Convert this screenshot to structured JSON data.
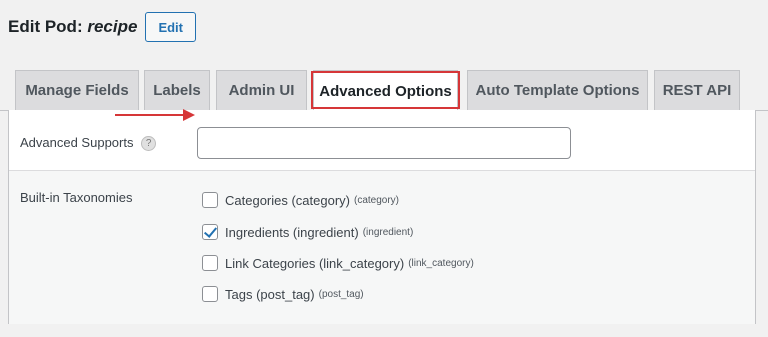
{
  "header": {
    "title_prefix": "Edit Pod:",
    "pod_name": "recipe",
    "edit_label": "Edit"
  },
  "tabs": [
    {
      "label": "Manage Fields"
    },
    {
      "label": "Labels"
    },
    {
      "label": "Admin UI"
    },
    {
      "label": "Advanced Options",
      "active": true
    },
    {
      "label": "Auto Template Options"
    },
    {
      "label": "REST API"
    }
  ],
  "advanced_supports": {
    "label": "Advanced Supports",
    "help_icon": "question-circle-icon",
    "value": ""
  },
  "taxonomies": {
    "label": "Built-in Taxonomies",
    "items": [
      {
        "label": "Categories (category)",
        "slug": "(category)",
        "checked": false
      },
      {
        "label": "Ingredients (ingredient)",
        "slug": "(ingredient)",
        "checked": true
      },
      {
        "label": "Link Categories (link_category)",
        "slug": "(link_category)",
        "checked": false
      },
      {
        "label": "Tags (post_tag)",
        "slug": "(post_tag)",
        "checked": false
      }
    ]
  },
  "colors": {
    "accent": "#2271b1",
    "highlight": "#d63638"
  }
}
